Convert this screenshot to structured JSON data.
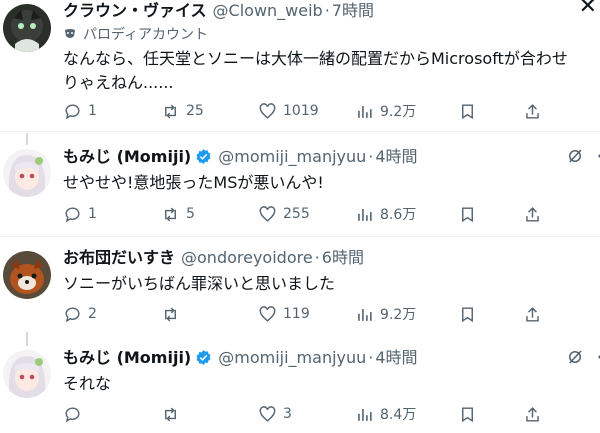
{
  "tweets": [
    {
      "name": "クラウン・ヴァイス",
      "handle": "@Clown_weib",
      "time": "7時間",
      "label": "パロディアカウント",
      "text": "なんなら、任天堂とソニーは大体一緒の配置だからMicrosoftが合わせりゃえねん......",
      "replies": "1",
      "reposts": "25",
      "likes": "1019",
      "views": "9.2万",
      "avatar_icon": "dark-character-avatar"
    },
    {
      "name": "もみじ (Momiji)",
      "handle": "@momiji_manjyuu",
      "time": "4時間",
      "text": "せやせや!意地張ったMSが悪いんや!",
      "replies": "1",
      "reposts": "5",
      "likes": "255",
      "views": "8.6万",
      "avatar_icon": "anime-girl-avatar"
    },
    {
      "name": "お布団だいすき",
      "handle": "@ondoreyoidore",
      "time": "6時間",
      "text": "ソニーがいちばん罪深いと思いました",
      "replies": "2",
      "reposts": "",
      "likes": "119",
      "views": "9.2万",
      "avatar_icon": "red-panda-avatar"
    },
    {
      "name": "もみじ (Momiji)",
      "handle": "@momiji_manjyuu",
      "time": "4時間",
      "text": "それな",
      "replies": "",
      "reposts": "",
      "likes": "3",
      "views": "8.4万",
      "avatar_icon": "anime-girl-avatar"
    }
  ],
  "dot_sep": "·",
  "colors": {
    "text": "#0f1419",
    "muted": "#536471",
    "verified": "#1d9bf0",
    "divider": "#eff3f4"
  }
}
